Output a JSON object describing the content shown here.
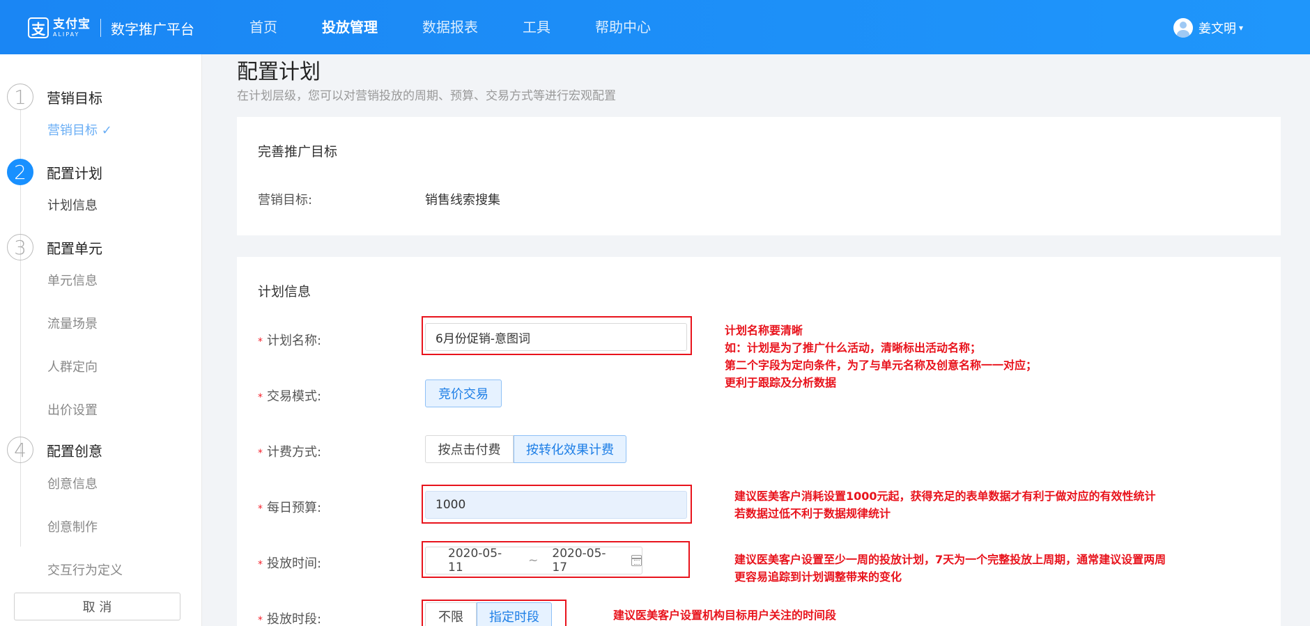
{
  "header": {
    "logo_mark": "支",
    "logo_cn": "支付宝",
    "logo_en": "ALIPAY",
    "platform": "数字推广平台",
    "nav": [
      "首页",
      "投放管理",
      "数据报表",
      "工具",
      "帮助中心"
    ],
    "active_nav": "投放管理",
    "user_name": "姜文明",
    "caret": "▾"
  },
  "sidebar": {
    "steps": [
      {
        "num": "1",
        "title": "营销目标",
        "subs": [
          "营销目标 ✓"
        ]
      },
      {
        "num": "2",
        "title": "配置计划",
        "subs": [
          "计划信息"
        ]
      },
      {
        "num": "3",
        "title": "配置单元",
        "subs": [
          "单元信息",
          "流量场景",
          "人群定向",
          "出价设置"
        ]
      },
      {
        "num": "4",
        "title": "配置创意",
        "subs": [
          "创意信息",
          "创意制作",
          "交互行为定义"
        ]
      }
    ],
    "cancel": "取 消"
  },
  "page": {
    "title": "配置计划",
    "desc": "在计划层级，您可以对营销投放的周期、预算、交易方式等进行宏观配置"
  },
  "goal_card": {
    "title": "完善推广目标",
    "label": "营销目标:",
    "value": "销售线索搜集"
  },
  "plan_card": {
    "title": "计划信息",
    "req_mark": "*",
    "name_label": "计划名称:",
    "name_value": "6月份促销-意图词",
    "mode_label": "交易模式:",
    "mode_value": "竞价交易",
    "billing_label": "计费方式:",
    "billing_options": [
      "按点击付费",
      "按转化效果计费"
    ],
    "billing_selected": "按转化效果计费",
    "budget_label": "每日预算:",
    "budget_value": "1000",
    "time_label": "投放时间:",
    "date_start": "2020-05-11",
    "date_sep": "~",
    "date_end": "2020-05-17",
    "period_label": "投放时段:",
    "period_options": [
      "不限",
      "指定时段"
    ],
    "period_selected": "指定时段"
  },
  "annotations": {
    "name_note": [
      "计划名称要清晰",
      "如：计划是为了推广什么活动，清晰标出活动名称；",
      "第二个字段为定向条件，为了与单元名称及创意名称一一对应；",
      "更利于跟踪及分析数据"
    ],
    "budget_note": [
      "建议医美客户消耗设置1000元起，获得充足的表单数据才有利于做对应的有效性统计",
      "若数据过低不利于数据规律统计"
    ],
    "time_note": [
      "建议医美客户设置至少一周的投放计划，7天为一个完整投放上周期，通常建议设置两周",
      "更容易追踪到计划调整带来的变化"
    ],
    "period_note": [
      "建议医美客户设置机构目标用户关注的时间段"
    ]
  },
  "colors": {
    "brand": "#1d8cf8",
    "active_step": "#1890ff",
    "annotation": "#e8131c"
  }
}
